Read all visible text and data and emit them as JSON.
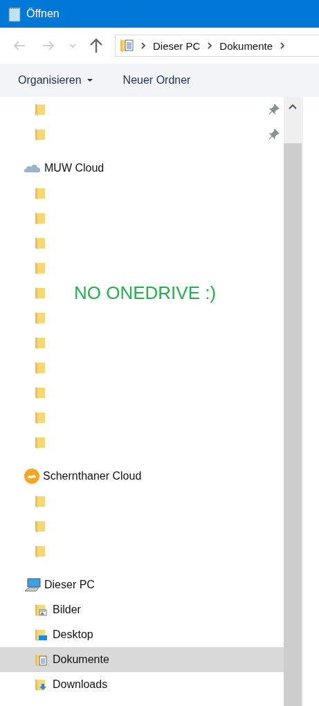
{
  "window": {
    "title": "Öffnen"
  },
  "address": {
    "path": [
      "Dieser PC",
      "Dokumente"
    ]
  },
  "nav": {
    "back_disabled": true,
    "forward_disabled": true
  },
  "commands": [
    {
      "label": "Organisieren",
      "dropdown": true
    },
    {
      "label": "Neuer Ordner",
      "dropdown": false
    }
  ],
  "tree": [
    {
      "kind": "none",
      "children": [
        {
          "kind": "folder",
          "pinned": true,
          "selected": false
        },
        {
          "kind": "folder",
          "pinned": true,
          "selected": false
        }
      ]
    },
    {
      "label": "MUW Cloud",
      "kind": "cloud",
      "children": [
        {
          "kind": "folder",
          "pinned": false,
          "selected": false
        },
        {
          "kind": "folder",
          "pinned": false,
          "selected": false
        },
        {
          "kind": "folder",
          "pinned": false,
          "selected": false
        },
        {
          "kind": "folder",
          "pinned": false,
          "selected": false
        },
        {
          "kind": "folder",
          "pinned": false,
          "selected": false
        },
        {
          "kind": "folder",
          "pinned": false,
          "selected": false
        },
        {
          "kind": "folder",
          "pinned": false,
          "selected": false
        },
        {
          "kind": "folder",
          "pinned": false,
          "selected": false
        },
        {
          "kind": "folder",
          "pinned": false,
          "selected": false
        },
        {
          "kind": "folder",
          "pinned": false,
          "selected": false
        },
        {
          "kind": "folder",
          "pinned": false,
          "selected": false
        }
      ]
    },
    {
      "label": "Schernthaner Cloud",
      "kind": "sync",
      "children": [
        {
          "kind": "folder",
          "pinned": false,
          "selected": false
        },
        {
          "kind": "folder",
          "pinned": false,
          "selected": false
        },
        {
          "kind": "folder",
          "pinned": false,
          "selected": false
        }
      ]
    },
    {
      "label": "Dieser PC",
      "kind": "pc",
      "children": [
        {
          "label": "Bilder",
          "kind": "pictures",
          "pinned": false,
          "selected": false
        },
        {
          "label": "Desktop",
          "kind": "desktop",
          "pinned": false,
          "selected": false
        },
        {
          "label": "Dokumente",
          "kind": "documents",
          "pinned": false,
          "selected": true
        },
        {
          "label": "Downloads",
          "kind": "downloads",
          "pinned": false,
          "selected": false
        }
      ]
    }
  ],
  "annotation": "NO ONEDRIVE :)"
}
